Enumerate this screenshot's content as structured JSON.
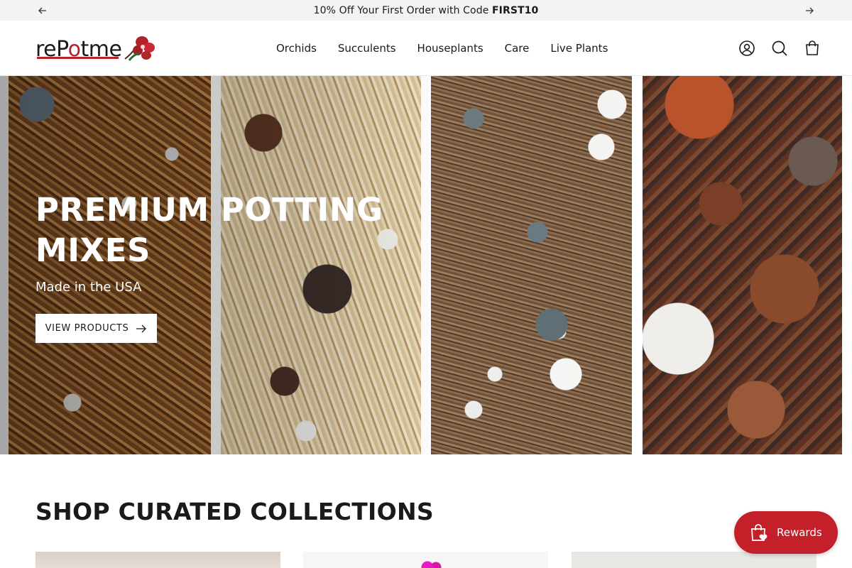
{
  "announcement": {
    "text_prefix": "10% Off Your First Order with Code ",
    "code": "FIRST10"
  },
  "header": {
    "logo": {
      "text_part1": "reP",
      "text_o": "o",
      "text_part2": "tme",
      "icon": "orchid-flower-logo"
    },
    "nav": [
      "Orchids",
      "Succulents",
      "Houseplants",
      "Care",
      "Live Plants"
    ],
    "icons": [
      "account-icon",
      "search-icon",
      "cart-icon"
    ]
  },
  "hero": {
    "title": "PREMIUM POTTING MIXES",
    "subtitle": "Made in the USA",
    "button_label": "VIEW PRODUCTS"
  },
  "collections": {
    "title": "SHOP CURATED COLLECTIONS"
  },
  "rewards": {
    "label": "Rewards",
    "accent": "#c4202a"
  }
}
